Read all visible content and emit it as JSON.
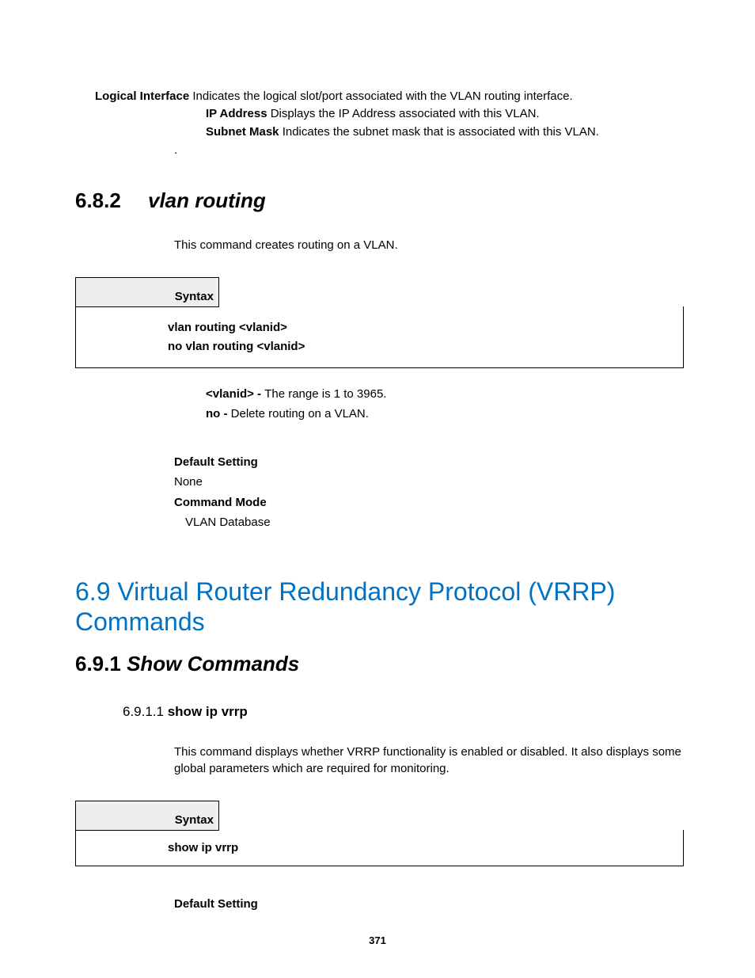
{
  "defs": {
    "li_term": "Logical Interface",
    "li_desc": " Indicates the logical slot/port associated with the VLAN routing interface.",
    "ip_term": "IP Address",
    "ip_desc": " Displays the IP Address associated with this VLAN.",
    "sm_term": "Subnet Mask",
    "sm_desc": " Indicates the subnet mask that is associated with this VLAN.",
    "dot": "."
  },
  "sec682": {
    "num": "6.8.2",
    "title": "vlan routing",
    "desc": "This command creates routing on a VLAN.",
    "syntax_label": "Syntax",
    "syntax_line1": "vlan routing <vlanid>",
    "syntax_line2": "no vlan routing <vlanid>",
    "param1_term": "<vlanid> - ",
    "param1_desc": "The range is 1 to 3965.",
    "param2_term": "no - ",
    "param2_desc": "Delete routing on a VLAN.",
    "default_label": "Default Setting",
    "default_value": "None",
    "mode_label": "Command Mode",
    "mode_value": "VLAN Database"
  },
  "sec69": {
    "title": "6.9 Virtual Router Redundancy Protocol (VRRP) Commands"
  },
  "sec691": {
    "num": "6.9.1 ",
    "title": "Show Commands"
  },
  "sec6911": {
    "num": "6.9.1.1 ",
    "title": "show ip vrrp",
    "desc": "This command displays whether VRRP functionality is enabled or disabled. It also displays some global parameters which are required for monitoring.",
    "syntax_label": "Syntax",
    "syntax_line1": "show ip vrrp",
    "default_label": "Default Setting"
  },
  "page_number": "371"
}
